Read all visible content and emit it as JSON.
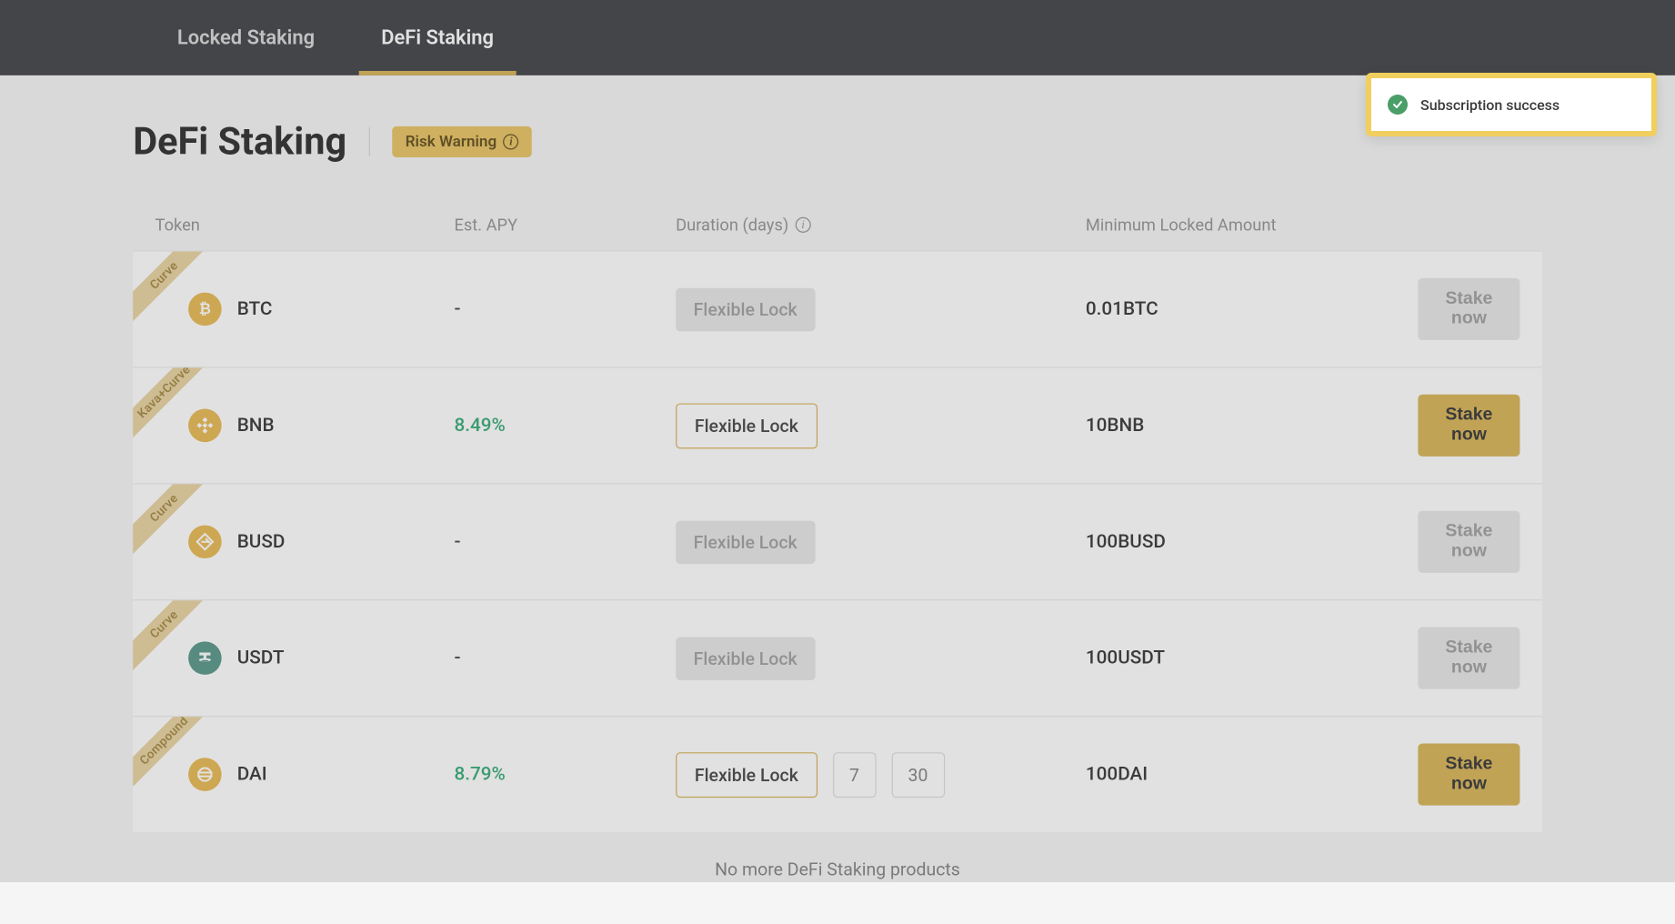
{
  "tabs": {
    "locked": "Locked Staking",
    "defi": "DeFi Staking"
  },
  "header": {
    "title": "DeFi Staking",
    "risk_label": "Risk Warning"
  },
  "columns": {
    "token": "Token",
    "apy": "Est. APY",
    "duration": "Duration (days)",
    "minimum": "Minimum Locked Amount"
  },
  "duration_label": "Flexible Lock",
  "stake_label": "Stake now",
  "rows": [
    {
      "ribbon": "Curve",
      "symbol": "BTC",
      "apy": "-",
      "apy_style": "dash",
      "duration_enabled": false,
      "extra_durations": [],
      "minimum": "0.01BTC",
      "stake_enabled": false,
      "coin_bg": "#e7b54a",
      "coin_glyph": "btc"
    },
    {
      "ribbon": "Kava+Curve",
      "symbol": "BNB",
      "apy": "8.49%",
      "apy_style": "green",
      "duration_enabled": true,
      "extra_durations": [],
      "minimum": "10BNB",
      "stake_enabled": true,
      "coin_bg": "#e7b54a",
      "coin_glyph": "bnb"
    },
    {
      "ribbon": "Curve",
      "symbol": "BUSD",
      "apy": "-",
      "apy_style": "dash",
      "duration_enabled": false,
      "extra_durations": [],
      "minimum": "100BUSD",
      "stake_enabled": false,
      "coin_bg": "#e7b54a",
      "coin_glyph": "busd"
    },
    {
      "ribbon": "Curve",
      "symbol": "USDT",
      "apy": "-",
      "apy_style": "dash",
      "duration_enabled": false,
      "extra_durations": [],
      "minimum": "100USDT",
      "stake_enabled": false,
      "coin_bg": "#4f9183",
      "coin_glyph": "usdt"
    },
    {
      "ribbon": "Compound",
      "symbol": "DAI",
      "apy": "8.79%",
      "apy_style": "green",
      "duration_enabled": true,
      "extra_durations": [
        "7",
        "30"
      ],
      "minimum": "100DAI",
      "stake_enabled": true,
      "coin_bg": "#e7b54a",
      "coin_glyph": "dai"
    }
  ],
  "footer": "No more DeFi Staking products",
  "toast": {
    "message": "Subscription success"
  }
}
